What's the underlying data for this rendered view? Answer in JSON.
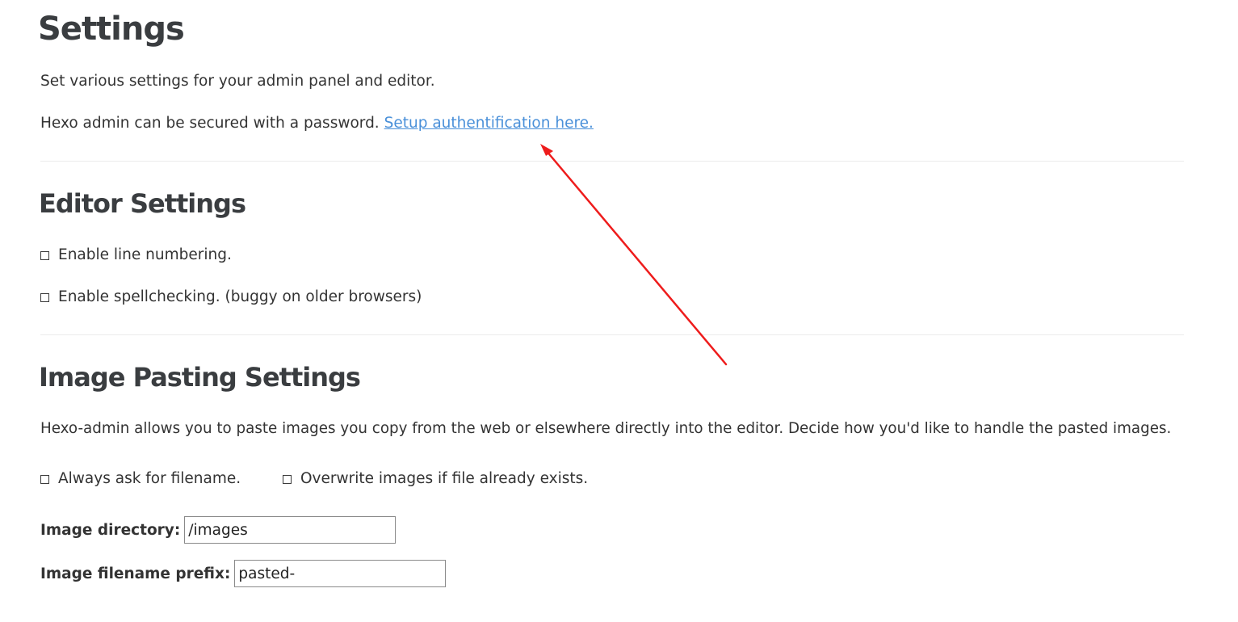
{
  "header": {
    "title": "Settings",
    "intro": "Set various settings for your admin panel and editor.",
    "auth_text": "Hexo admin can be secured with a password.",
    "auth_link": "Setup authentification here."
  },
  "editor_settings": {
    "title": "Editor Settings",
    "options": [
      {
        "label": "Enable line numbering.",
        "checked": false
      },
      {
        "label": "Enable spellchecking. (buggy on older browsers)",
        "checked": false
      }
    ]
  },
  "image_settings": {
    "title": "Image Pasting Settings",
    "description": "Hexo-admin allows you to paste images you copy from the web or elsewhere directly into the editor. Decide how you'd like to handle the pasted images.",
    "options": [
      {
        "label": "Always ask for filename.",
        "checked": false
      },
      {
        "label": "Overwrite images if file already exists.",
        "checked": false
      }
    ],
    "fields": [
      {
        "label": "Image directory:",
        "value": "/images"
      },
      {
        "label": "Image filename prefix:",
        "value": "pasted-"
      }
    ]
  },
  "colors": {
    "link": "#4a90d9",
    "annotation_arrow": "#ee1c1c",
    "heading": "#3a3d40"
  }
}
